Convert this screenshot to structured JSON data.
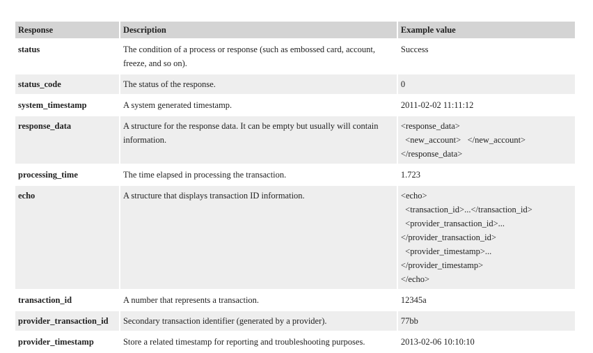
{
  "table": {
    "headers": {
      "response": "Response",
      "description": "Description",
      "example": "Example value"
    },
    "rows": [
      {
        "name": "status",
        "description": "The condition of a process or response (such as embossed card, account, freeze, and so on).",
        "example": [
          "Success"
        ]
      },
      {
        "name": "status_code",
        "description": "The status of the response.",
        "example": [
          "0"
        ]
      },
      {
        "name": "system_timestamp",
        "description": "A system generated timestamp.",
        "example": [
          "2011-02-02 11:11:12"
        ]
      },
      {
        "name": "response_data",
        "description": "A structure for the response data. It can be empty but usually will contain information.",
        "example": [
          "<response_data>",
          "  <new_account>   </new_account>",
          "</response_data>"
        ]
      },
      {
        "name": "processing_time",
        "description": "The time elapsed in processing the transaction.",
        "example": [
          "1.723"
        ]
      },
      {
        "name": "echo",
        "description": "A structure that displays transaction ID information.",
        "example": [
          "<echo>",
          "  <transaction_id>...</transaction_id>",
          "  <provider_transaction_id>...",
          "</provider_transaction_id>",
          "  <provider_timestamp>...",
          "</provider_timestamp>",
          "</echo>"
        ]
      },
      {
        "name": "transaction_id",
        "description": "A number that represents a transaction.",
        "example": [
          "12345a"
        ]
      },
      {
        "name": "provider_transaction_id",
        "description": "Secondary transaction identifier (generated by a provider).",
        "example": [
          "77bb"
        ]
      },
      {
        "name": "provider_timestamp",
        "description": "Store a related timestamp for reporting and troubleshooting purposes.",
        "example": [
          "2013-02-06 10:10:10"
        ]
      }
    ]
  }
}
